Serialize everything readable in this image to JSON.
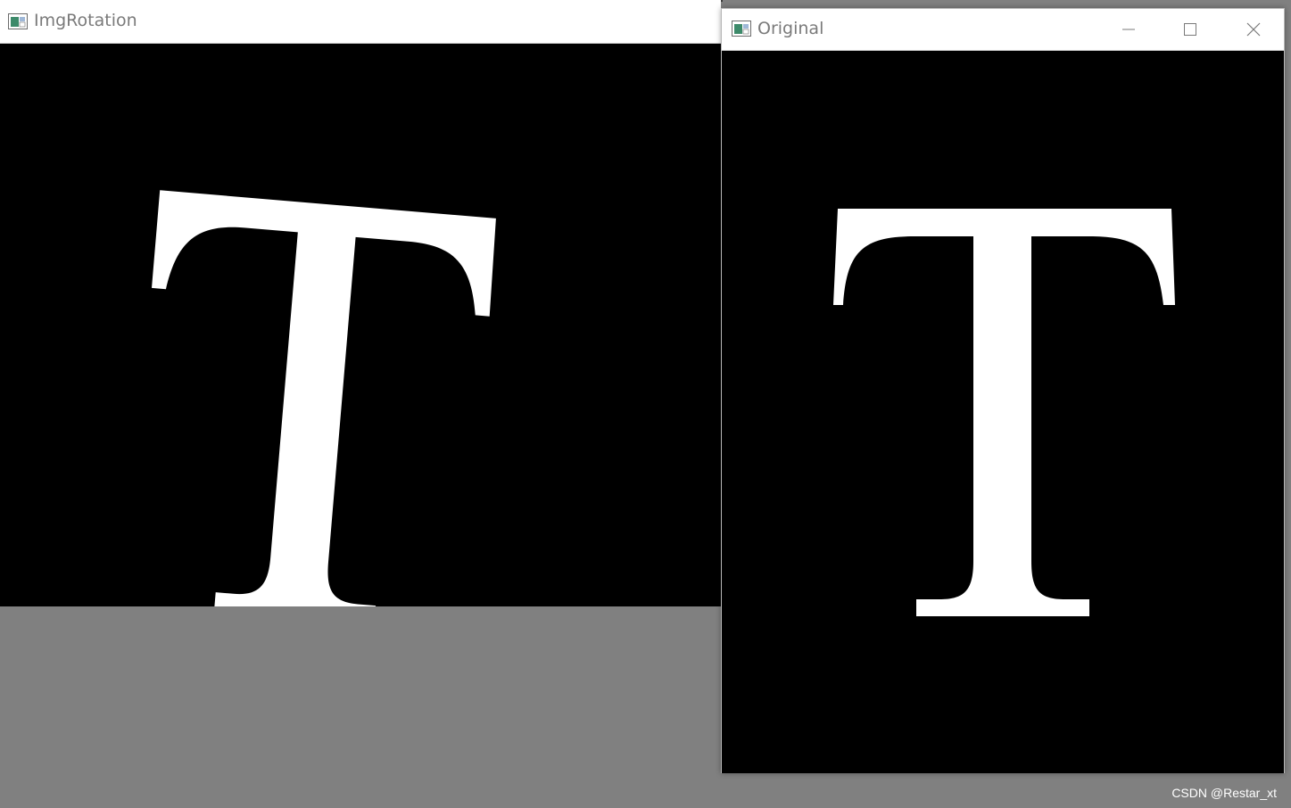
{
  "rotated_window": {
    "title": "ImgRotation",
    "icon": "opencv-window-icon",
    "image_glyph": "T",
    "rotation_degrees": 5
  },
  "original_window": {
    "title": "Original",
    "icon": "opencv-window-icon",
    "image_glyph": "T",
    "controls": {
      "minimize": "minimize-icon",
      "maximize": "maximize-icon",
      "close": "close-icon"
    }
  },
  "watermark": "CSDN @Restar_xt",
  "colors": {
    "canvas": "#000000",
    "glyph": "#ffffff",
    "desktop": "#808080",
    "titlebar": "#ffffff"
  }
}
